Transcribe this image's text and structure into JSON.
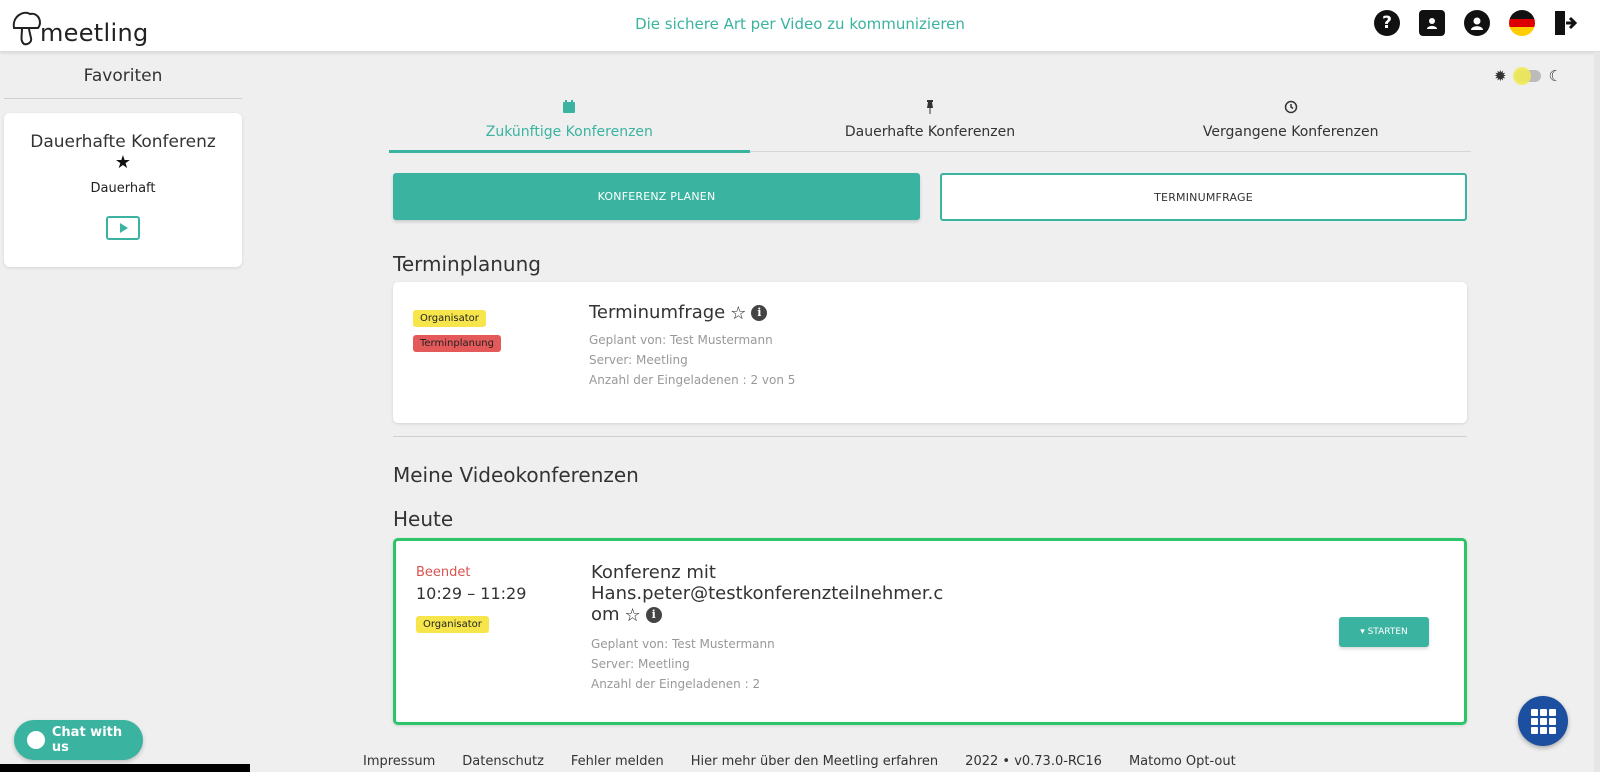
{
  "header": {
    "logo_text": "meetling",
    "tagline": "Die sichere Art per Video zu kommunizieren",
    "icons": [
      "help-icon",
      "contacts-icon",
      "account-icon",
      "german-flag-icon",
      "logout-icon"
    ],
    "help_glyph": "?"
  },
  "sidebar": {
    "title": "Favoriten",
    "card": {
      "title": "Dauerhafte Konferenz",
      "star": "★",
      "subtitle": "Dauerhaft"
    }
  },
  "tabs": [
    {
      "label": "Zukünftige Konferenzen",
      "icon": "calendar-icon",
      "active": true
    },
    {
      "label": "Dauerhafte Konferenzen",
      "icon": "pin-icon",
      "active": false
    },
    {
      "label": "Vergangene Konferenzen",
      "icon": "history-icon",
      "active": false
    }
  ],
  "buttons": {
    "plan": "KONFERENZ PLANEN",
    "poll": "TERMINUMFRAGE"
  },
  "scheduling": {
    "heading": "Terminplanung",
    "card": {
      "badge_organizer": "Organisator",
      "badge_scheduling": "Terminplanung",
      "title": "Terminumfrage",
      "planned_by": "Geplant von: Test Mustermann",
      "server": "Server: Meetling",
      "invited": "Anzahl der Eingeladenen : 2 von 5"
    }
  },
  "conferences": {
    "heading": "Meine Videokonferenzen",
    "today_heading": "Heute",
    "card": {
      "status": "Beendet",
      "time": "10:29 – 11:29",
      "badge_organizer": "Organisator",
      "title_line1": "Konferenz mit",
      "title_line2": "Hans.peter@testkonferenzteilnehmer.c",
      "title_line3": "om",
      "planned_by": "Geplant von: Test Mustermann",
      "server": "Server: Meetling",
      "invited": "Anzahl der Eingeladenen : 2",
      "start_button": "▾ STARTEN"
    }
  },
  "footer": {
    "links": [
      "Impressum",
      "Datenschutz",
      "Fehler melden",
      "Hier mehr über den Meetling erfahren",
      "2022 • v0.73.0-RC16",
      "Matomo Opt-out"
    ]
  },
  "chat": {
    "label": "Chat with us"
  },
  "colors": {
    "accent": "#3ab3a0",
    "active_border": "#2ec46a",
    "danger": "#d9534f",
    "fab": "#1d4fa0"
  }
}
